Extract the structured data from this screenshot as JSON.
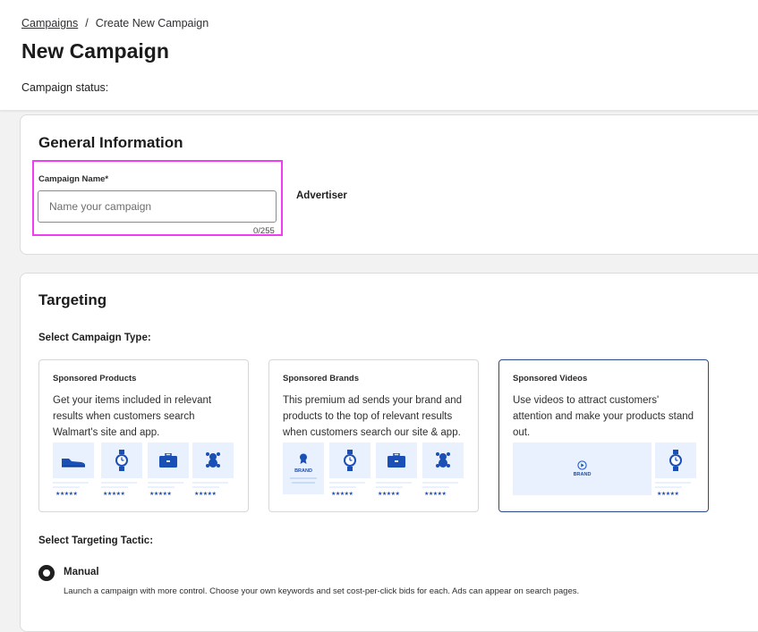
{
  "breadcrumb": {
    "parent": "Campaigns",
    "separator": "/",
    "current": "Create New Campaign"
  },
  "header": {
    "title": "New Campaign",
    "status_label": "Campaign status:"
  },
  "general": {
    "title": "General Information",
    "campaign_name_label": "Campaign Name*",
    "campaign_name_value": "",
    "campaign_name_placeholder": "Name your campaign",
    "char_count": "0/255",
    "advertiser_label": "Advertiser"
  },
  "targeting": {
    "title": "Targeting",
    "campaign_type_label": "Select Campaign Type:",
    "types": [
      {
        "title": "Sponsored Products",
        "description": "Get your items included in relevant results when customers search Walmart's site and app.",
        "icons": [
          "shoe-icon",
          "watch-icon",
          "briefcase-icon",
          "toy-icon"
        ],
        "selected": false
      },
      {
        "title": "Sponsored Brands",
        "description": "This premium ad sends your brand and products to the top of relevant results when customers search our site & app.",
        "brand_text": "BRAND",
        "icons": [
          "watch-icon",
          "briefcase-icon",
          "toy-icon"
        ],
        "selected": false
      },
      {
        "title": "Sponsored Videos",
        "description": "Use videos to attract customers' attention and make your products stand out.",
        "brand_text": "BRAND",
        "icons": [
          "play-icon",
          "watch-icon"
        ],
        "selected": true
      }
    ],
    "rating_stars": "★★★★★",
    "tactic_label": "Select Targeting Tactic:",
    "tactic": {
      "label": "Manual",
      "description": "Launch a campaign with more control. Choose your own keywords and set cost-per-click bids for each. Ads can appear on search pages.",
      "selected": true
    }
  },
  "colors": {
    "highlight": "#f23cf2",
    "accent": "#1a4fb5",
    "selected_border": "#2a4a8f",
    "thumb_bg": "#e8f1fd"
  }
}
